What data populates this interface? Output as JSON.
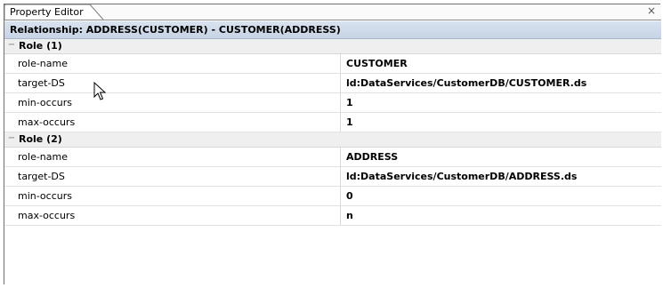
{
  "panel": {
    "tab_label": "Property Editor",
    "close_glyph": "×"
  },
  "header": {
    "title": "Relationship: ADDRESS(CUSTOMER) - CUSTOMER(ADDRESS)"
  },
  "groups": [
    {
      "label": "Role (1)",
      "collapse_glyph": "−",
      "rows": [
        {
          "name": "role-name",
          "value": "CUSTOMER"
        },
        {
          "name": "target-DS",
          "value": "ld:DataServices/CustomerDB/CUSTOMER.ds"
        },
        {
          "name": "min-occurs",
          "value": "1"
        },
        {
          "name": "max-occurs",
          "value": "1"
        }
      ]
    },
    {
      "label": "Role (2)",
      "collapse_glyph": "−",
      "rows": [
        {
          "name": "role-name",
          "value": "ADDRESS"
        },
        {
          "name": "target-DS",
          "value": "ld:DataServices/CustomerDB/ADDRESS.ds"
        },
        {
          "name": "min-occurs",
          "value": "0"
        },
        {
          "name": "max-occurs",
          "value": "n"
        }
      ]
    }
  ],
  "colors": {
    "header_bg": "#c7d4e6",
    "group_bg": "#efefef"
  },
  "icons": {
    "cursor": "mouse-pointer-icon",
    "close": "close-icon",
    "collapse": "collapse-icon"
  }
}
